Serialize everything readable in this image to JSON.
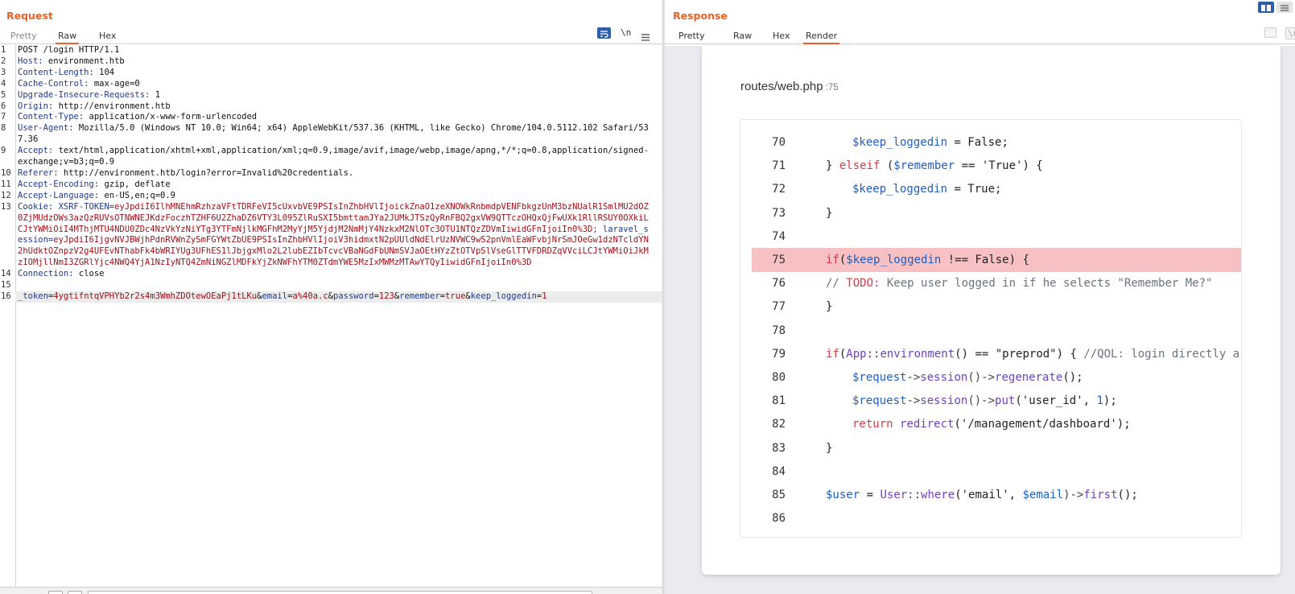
{
  "request": {
    "title": "Request",
    "tabs": [
      "Pretty",
      "Raw",
      "Hex"
    ],
    "active_tab": "Raw",
    "toolbar": {
      "wrap_icon": "wrap-lines-icon",
      "newline_label": "\\n",
      "menu_icon": "hamburger-menu-icon"
    },
    "lines": [
      {
        "n": "1",
        "plain": "POST /login HTTP/1.1"
      },
      {
        "n": "2",
        "name": "Host:",
        "value": " environment.htb"
      },
      {
        "n": "3",
        "name": "Content-Length:",
        "value": " 104"
      },
      {
        "n": "4",
        "name": "Cache-Control:",
        "value": " max-age=0"
      },
      {
        "n": "5",
        "name": "Upgrade-Insecure-Requests:",
        "value": " 1"
      },
      {
        "n": "6",
        "name": "Origin:",
        "value": " http://environment.htb"
      },
      {
        "n": "7",
        "name": "Content-Type:",
        "value": " application/x-www-form-urlencoded"
      },
      {
        "n": "8",
        "name": "User-Agent:",
        "value": " Mozilla/5.0 (Windows NT 10.0; Win64; x64) AppleWebKit/537.36 (KHTML, like Gecko) Chrome/104.0.5112.102 Safari/537.36"
      },
      {
        "n": "9",
        "name": "Accept:",
        "value": " text/html,application/xhtml+xml,application/xml;q=0.9,image/avif,image/webp,image/apng,*/*;q=0.8,application/signed-exchange;v=b3;q=0.9"
      },
      {
        "n": "10",
        "name": "Referer:",
        "value": " http://environment.htb/login?error=Invalid%20credentials."
      },
      {
        "n": "11",
        "name": "Accept-Encoding:",
        "value": " gzip, deflate"
      },
      {
        "n": "12",
        "name": "Accept-Language:",
        "value": " en-US,en;q=0.9"
      },
      {
        "n": "13",
        "cookie": true,
        "name": "Cookie:",
        "c1_key": " XSRF-TOKEN=",
        "c1_val": "eyJpdiI6IlhMNEhmRzhzaVFtTDRFeVI5cUxvbVE9PSIsInZhbHVlIjoickZnaO1zeXNOWkRnbmdpVENFbkgzUnM3bzNUalR1SmlMU2dOZ0ZjMUdzOWs3azQzRUVsOTNWNEJKdzFoczhTZHF6U2ZhaDZ6VTY3L095ZlRuSXI5bmttamJYa2JUMkJTSzQyRnFBQ2gxVW9QTTczOHQxQjFwUXk1RllRSUY0OXkiLCJtYWMiOiI4MThjMTU4NDU0ZDc4NzVkYzNiYTg3YTFmNjlkMGFhM2MyYjM5YjdjM2NmMjY4NzkxM2NlOTc3OTU1NTQzZDVmIiwidGFnIjoiIn0%3D;",
        "c2_key": " laravel_session=",
        "c2_val": "eyJpdiI6IjgvNVJBWjhPdnRVWnZySmFGYWtZbUE9PSIsInZhbHVlIjoiV3hidmxtN2pUUldNdElrUzNVWC9wS2pnVmlEaWFvbjNrSmJOeGw1dzNTcldYN2hUdktOZnpzV2g4UFEvNThabFk4bWRIYUg3UFhES1lJbjgxMlo2L2lubEZIbTcvcVBaNGdFbUNmSVJaOEtHYzZtOTVpSlVseGlTTVFDRDZqVVciLCJtYWMiOiJkMzIOMjllNmI3ZGRlYjc4NWQ4YjA1NzIyNTQ4ZmNiNGZlMDFkYjZkNWFhYTM0ZTdmYWE5MzIxMWMzMTAwYTQyIiwidGFnIjoiIn0%3D"
      },
      {
        "n": "14",
        "name": "Connection:",
        "value": " close"
      },
      {
        "n": "15",
        "plain": ""
      },
      {
        "n": "16",
        "body": true
      }
    ],
    "body_params": [
      {
        "key": "_token",
        "val": "4ygtifntqVPHYb2r2s4m3WmhZDOtewOEaPj1tLKu"
      },
      {
        "key": "email",
        "val": "a%40a.c"
      },
      {
        "key": "password",
        "val": "123"
      },
      {
        "key": "remember",
        "val": "true"
      },
      {
        "key": "keep_loggedin",
        "val": "1"
      }
    ]
  },
  "response": {
    "title": "Response",
    "tabs": [
      "Pretty",
      "Raw",
      "Hex",
      "Render"
    ],
    "active_tab": "Render",
    "newline_label": "\\n",
    "file": {
      "name": "routes/web.php",
      "line": ":75"
    },
    "highlight_line": "75",
    "code_lines": [
      {
        "n": "70"
      },
      {
        "n": "71"
      },
      {
        "n": "72"
      },
      {
        "n": "73"
      },
      {
        "n": "74"
      },
      {
        "n": "75"
      },
      {
        "n": "76"
      },
      {
        "n": "77"
      },
      {
        "n": "78"
      },
      {
        "n": "79"
      },
      {
        "n": "80"
      },
      {
        "n": "81"
      },
      {
        "n": "82"
      },
      {
        "n": "83"
      },
      {
        "n": "84"
      },
      {
        "n": "85"
      },
      {
        "n": "86"
      }
    ],
    "code": {
      "l70": [
        "$keep_loggedin",
        " = False;"
      ],
      "l71": [
        "} ",
        "elseif",
        " (",
        "$remember",
        " == ",
        "'True'",
        ") {"
      ],
      "l72": [
        "$keep_loggedin",
        " = True;"
      ],
      "l73": [
        "}"
      ],
      "l75": [
        "if",
        "(",
        "$keep_loggedin",
        " !== False) {"
      ],
      "l76": [
        "// ",
        "TODO:",
        " Keep user logged in if he selects \"Remember Me?\""
      ],
      "l77": [
        "}"
      ],
      "l79": [
        "if",
        "(",
        "App",
        "::",
        "environment",
        "() == ",
        "\"preprod\"",
        ") { ",
        "//QOL: login directly a"
      ],
      "l80": [
        "$request",
        "->",
        "session",
        "()->",
        "regenerate",
        "();"
      ],
      "l81": [
        "$request",
        "->",
        "session",
        "()->",
        "put",
        "(",
        "'user_id'",
        ", ",
        "1",
        ");"
      ],
      "l82": [
        "return",
        " ",
        "redirect",
        "(",
        "'/management/dashboard'",
        ");"
      ],
      "l83": [
        "}"
      ],
      "l85": [
        "$user",
        " = ",
        "User",
        "::",
        "where",
        "(",
        "'email'",
        ", ",
        "$email",
        ")->",
        "first",
        "();"
      ]
    },
    "colors": {
      "accent": "#e8622a",
      "highlight": "#f7c1c3"
    }
  }
}
